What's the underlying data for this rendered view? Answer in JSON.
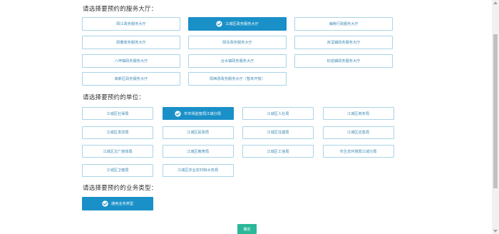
{
  "sections": {
    "hall_title": "请选择要预约的服务大厅：",
    "unit_title": "请选择要预约的单位：",
    "type_title": "请选择要预约的业务类型："
  },
  "halls": [
    {
      "label": "阳江政务服务大厅",
      "selected": false
    },
    {
      "label": "江城区政务服务大厅",
      "selected": true
    },
    {
      "label": "海陵行政服务大厅",
      "selected": false
    },
    {
      "label": "阳春政务服务大厅",
      "selected": false
    },
    {
      "label": "阳东政务服务大厅",
      "selected": false
    },
    {
      "label": "双滘镇政务服务大厅",
      "selected": false
    },
    {
      "label": "八甲镇政务服务大厅",
      "selected": false
    },
    {
      "label": "合水镇政务服务大厅",
      "selected": false
    },
    {
      "label": "松柏镇政务服务大厅",
      "selected": false
    },
    {
      "label": "高新区政务服务大厅",
      "selected": false
    },
    {
      "label": "阳西县政务服务大厅（暂未开放）",
      "selected": false
    }
  ],
  "units": [
    {
      "label": "江城区社保局",
      "selected": false
    },
    {
      "label": "市市场监管局江城分局",
      "selected": true
    },
    {
      "label": "江城区人社局",
      "selected": false
    },
    {
      "label": "江城区商务局",
      "selected": false
    },
    {
      "label": "江城区发改局",
      "selected": false
    },
    {
      "label": "江城区民政局",
      "selected": false
    },
    {
      "label": "江城区住建局",
      "selected": false
    },
    {
      "label": "江城区应急局",
      "selected": false
    },
    {
      "label": "江城区文广旅体局",
      "selected": false
    },
    {
      "label": "江城区教育局",
      "selected": false
    },
    {
      "label": "江城区工信局",
      "selected": false
    },
    {
      "label": "市生态环境局江城分局",
      "selected": false
    },
    {
      "label": "江城区卫健局",
      "selected": false
    },
    {
      "label": "江城区农业农村和水务局",
      "selected": false
    }
  ],
  "business_types": [
    {
      "label": "通用业务类型",
      "selected": true
    }
  ],
  "confirm_label": "确定",
  "colors": {
    "accent": "#1a90c8",
    "border": "#a9d4e6",
    "option_text": "#3f8ab3",
    "confirm": "#2bb89a"
  },
  "icons": {
    "selected": "check-circle-icon",
    "scroll_up": "arrow-up-icon",
    "scroll_down": "arrow-down-icon"
  }
}
